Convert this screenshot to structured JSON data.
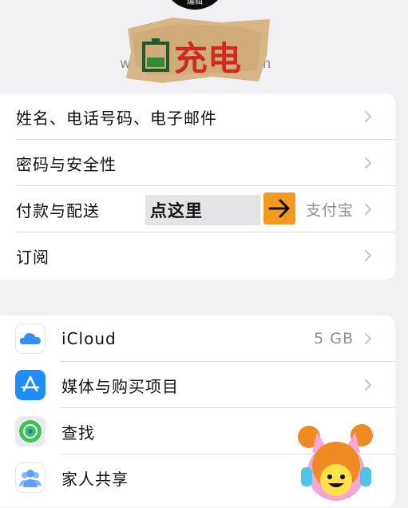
{
  "header": {
    "edit_label": "编辑",
    "apple_id_prefix": "w",
    "apple_id_suffix": "om"
  },
  "sticker": {
    "text": "充电"
  },
  "account_section": {
    "items": [
      {
        "label": "姓名、电话号码、电子邮件",
        "value": ""
      },
      {
        "label": "密码与安全性",
        "value": ""
      },
      {
        "label": "付款与配送",
        "value": "支付宝"
      },
      {
        "label": "订阅",
        "value": ""
      }
    ],
    "annotation": {
      "text": "点这里",
      "arrow_icon": "arrow-right-icon",
      "arrow_color": "#f29a1f"
    }
  },
  "services_section": {
    "items": [
      {
        "label": "iCloud",
        "value": "5 GB",
        "icon": "icloud-icon"
      },
      {
        "label": "媒体与购买项目",
        "value": "",
        "icon": "app-store-icon"
      },
      {
        "label": "查找",
        "value": "",
        "icon": "find-my-icon"
      },
      {
        "label": "家人共享",
        "value": "",
        "icon": "family-sharing-icon"
      }
    ]
  },
  "colors": {
    "background": "#f1f1f4",
    "card": "#ffffff",
    "secondary_text": "#8e8e93",
    "chevron": "#c4c4c7",
    "icloud_blue": "#3a8ef0",
    "app_store_blue": "#1e8df5",
    "find_my_green": "#3cc35a",
    "family_blue": "#5aa2f2"
  }
}
